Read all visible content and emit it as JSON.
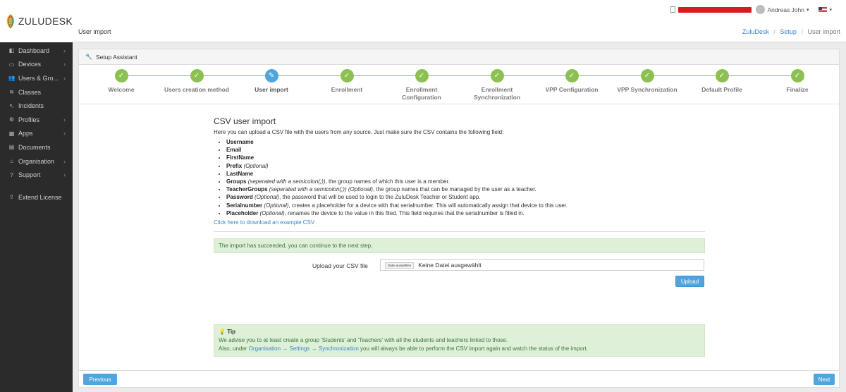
{
  "brand": {
    "name": "ZULUDESK"
  },
  "sidebar": {
    "items": [
      {
        "label": "Dashboard",
        "icon": "dashboard-icon",
        "chevron": true
      },
      {
        "label": "Devices",
        "icon": "devices-icon",
        "chevron": true
      },
      {
        "label": "Users & Gro...",
        "icon": "users-icon",
        "chevron": true
      },
      {
        "label": "Classes",
        "icon": "classes-icon",
        "chevron": false
      },
      {
        "label": "Incidents",
        "icon": "incidents-icon",
        "chevron": false
      },
      {
        "label": "Profiles",
        "icon": "profiles-icon",
        "chevron": true
      },
      {
        "label": "Apps",
        "icon": "apps-icon",
        "chevron": true
      },
      {
        "label": "Documents",
        "icon": "documents-icon",
        "chevron": false
      },
      {
        "label": "Organisation",
        "icon": "organisation-icon",
        "chevron": true
      },
      {
        "label": "Support",
        "icon": "support-icon",
        "chevron": true
      },
      {
        "label": "Extend License",
        "icon": "upload-icon",
        "chevron": false
      }
    ]
  },
  "topbar": {
    "user_name": "Andreas John",
    "user_caret": "▾",
    "lang_caret": "▾"
  },
  "header": {
    "page_title": "User import"
  },
  "breadcrumb": {
    "item1": "ZuluDesk",
    "item2": "Setup",
    "item3": "User import",
    "sep": "/"
  },
  "panel": {
    "title": "Setup Assistant"
  },
  "wizard": {
    "steps": [
      {
        "label": "Welcome",
        "state": "done"
      },
      {
        "label": "Users creation method",
        "state": "done"
      },
      {
        "label": "User import",
        "state": "active"
      },
      {
        "label": "Enrollment",
        "state": "done"
      },
      {
        "label": "Enrollment Configuration",
        "state": "done"
      },
      {
        "label": "Enrollment Synchronization",
        "state": "done"
      },
      {
        "label": "VPP Configuration",
        "state": "done"
      },
      {
        "label": "VPP Synchronization",
        "state": "done"
      },
      {
        "label": "Default Profile",
        "state": "done"
      },
      {
        "label": "Finalize",
        "state": "done"
      }
    ]
  },
  "csv": {
    "title": "CSV user import",
    "intro": "Here you can upload a CSV file with the users from any source. Just make sure the CSV contains the following field:",
    "fields": [
      {
        "name": "Username",
        "optional": "",
        "desc": ""
      },
      {
        "name": "Email",
        "optional": "",
        "desc": ""
      },
      {
        "name": "FirstName",
        "optional": "",
        "desc": ""
      },
      {
        "name": "Prefix",
        "optional": "(Optional)",
        "desc": ""
      },
      {
        "name": "LastName",
        "optional": "",
        "desc": ""
      },
      {
        "name": "Groups",
        "optional": "(seperated with a semicolon(;))",
        "desc": ", the group names of which this user is a member."
      },
      {
        "name": "TeacherGroups",
        "optional": "(seperated with a semicolon(;)) (Optional)",
        "desc": ", the group names that can be managed by the user as a teacher."
      },
      {
        "name": "Password",
        "optional": "(Optional)",
        "desc": ", the password that will be used to login to the ZuluDesk Teacher or Student app."
      },
      {
        "name": "Serialnumber",
        "optional": "(Optional)",
        "desc": ", creates a placeholder for a device with that serialnumber. This will automatically assign that device to this user."
      },
      {
        "name": "Placeholder",
        "optional": "(Optional)",
        "desc": ", renames the device to the value in this filed. This field requires that the serialnumber is filled in."
      }
    ],
    "download_link": "Click here to download an example CSV",
    "success_message": "The import has succeeded, you can continue to the next step.",
    "upload_label": "Upload your CSV file",
    "file_button": "Datei auswählen",
    "file_placeholder": "Keine Datei ausgewählt",
    "upload_button": "Upload"
  },
  "tip": {
    "title": "Tip",
    "line1": "We advise you to at least create a group 'Students' and 'Teachers' with all the students and teachers linked to those.",
    "line2_prefix": "Also, under ",
    "line2_link": "Organisation → Settings → Synchronization",
    "line2_suffix": " you will always be able to perform the CSV import again and watch the status of the import."
  },
  "footer": {
    "previous": "Previous",
    "next": "Next"
  },
  "colors": {
    "accent": "#4fa6dd",
    "success": "#8cc152",
    "sidebar": "#2b2b2b",
    "alert_bg": "#dff0d8"
  }
}
